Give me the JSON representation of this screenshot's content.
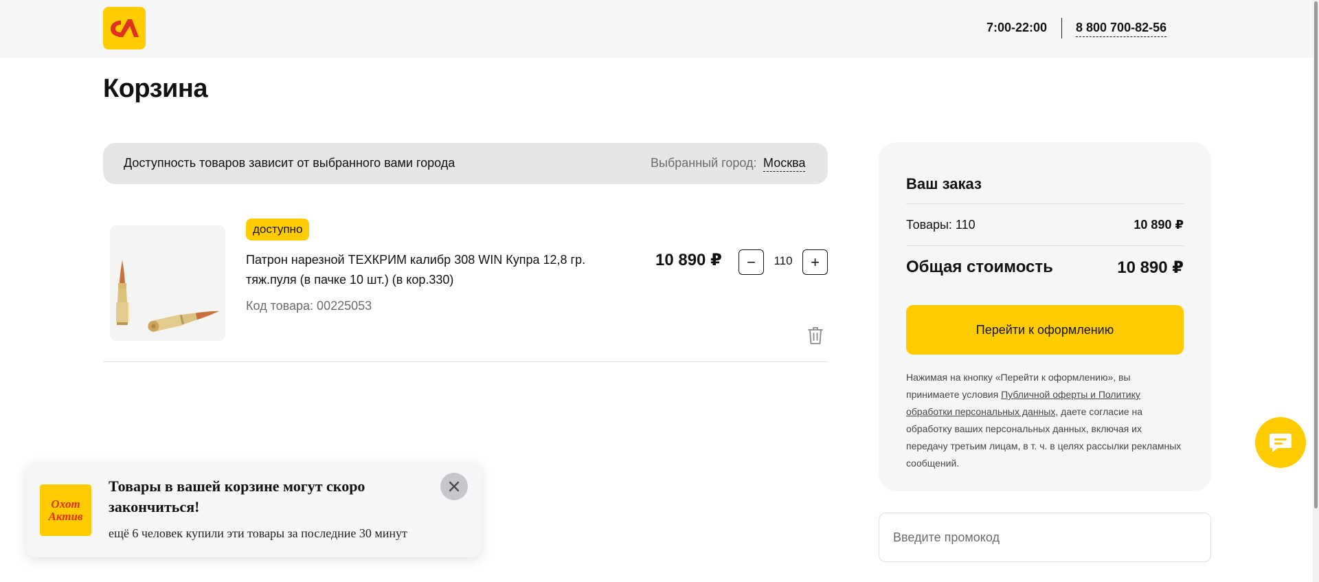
{
  "header": {
    "logo_icon": "brand-logo-icon",
    "hours": "7:00-22:00",
    "phone": "8 800 700-82-56"
  },
  "page": {
    "title": "Корзина"
  },
  "city_bar": {
    "note": "Доступность товаров зависит от выбранного вами города",
    "label": "Выбранный город:",
    "value": "Москва"
  },
  "cart_item": {
    "badge": "доступно",
    "name": "Патрон нарезной ТЕХКРИМ калибр 308 WIN Купра 12,8 гр. тяж.пуля (в пачке 10 шт.) (в кор.330)",
    "code": "Код товара: 00225053",
    "price": "10 890 ₽",
    "quantity": "110",
    "minus_label": "−",
    "plus_label": "+"
  },
  "order": {
    "title": "Ваш заказ",
    "goods_label": "Товары: 110",
    "goods_value": "10 890 ₽",
    "total_label": "Общая стоимость",
    "total_value": "10 890 ₽",
    "checkout_label": "Перейти к оформлению",
    "legal_pre": "Нажимая на кнопку «Перейти к оформлению», вы принимаете условия ",
    "legal_link": "Публичной оферты и Политику обработки персональных данных,",
    "legal_post": " даете согласие на обработку ваших персональных данных, включая их передачу третьим лицам, в т. ч. в целях рассылки рекламных сообщений."
  },
  "promo": {
    "placeholder": "Введите промокод"
  },
  "toast": {
    "logo_line1": "Охот",
    "logo_line2": "Актив",
    "title": "Товары в вашей корзине могут скоро закончиться!",
    "text": "ещё 6 человек купили эти товары за последние 30 минут"
  },
  "colors": {
    "accent": "#ffcc00",
    "logo_red": "#e0301e",
    "panel": "#f5f6f8"
  }
}
